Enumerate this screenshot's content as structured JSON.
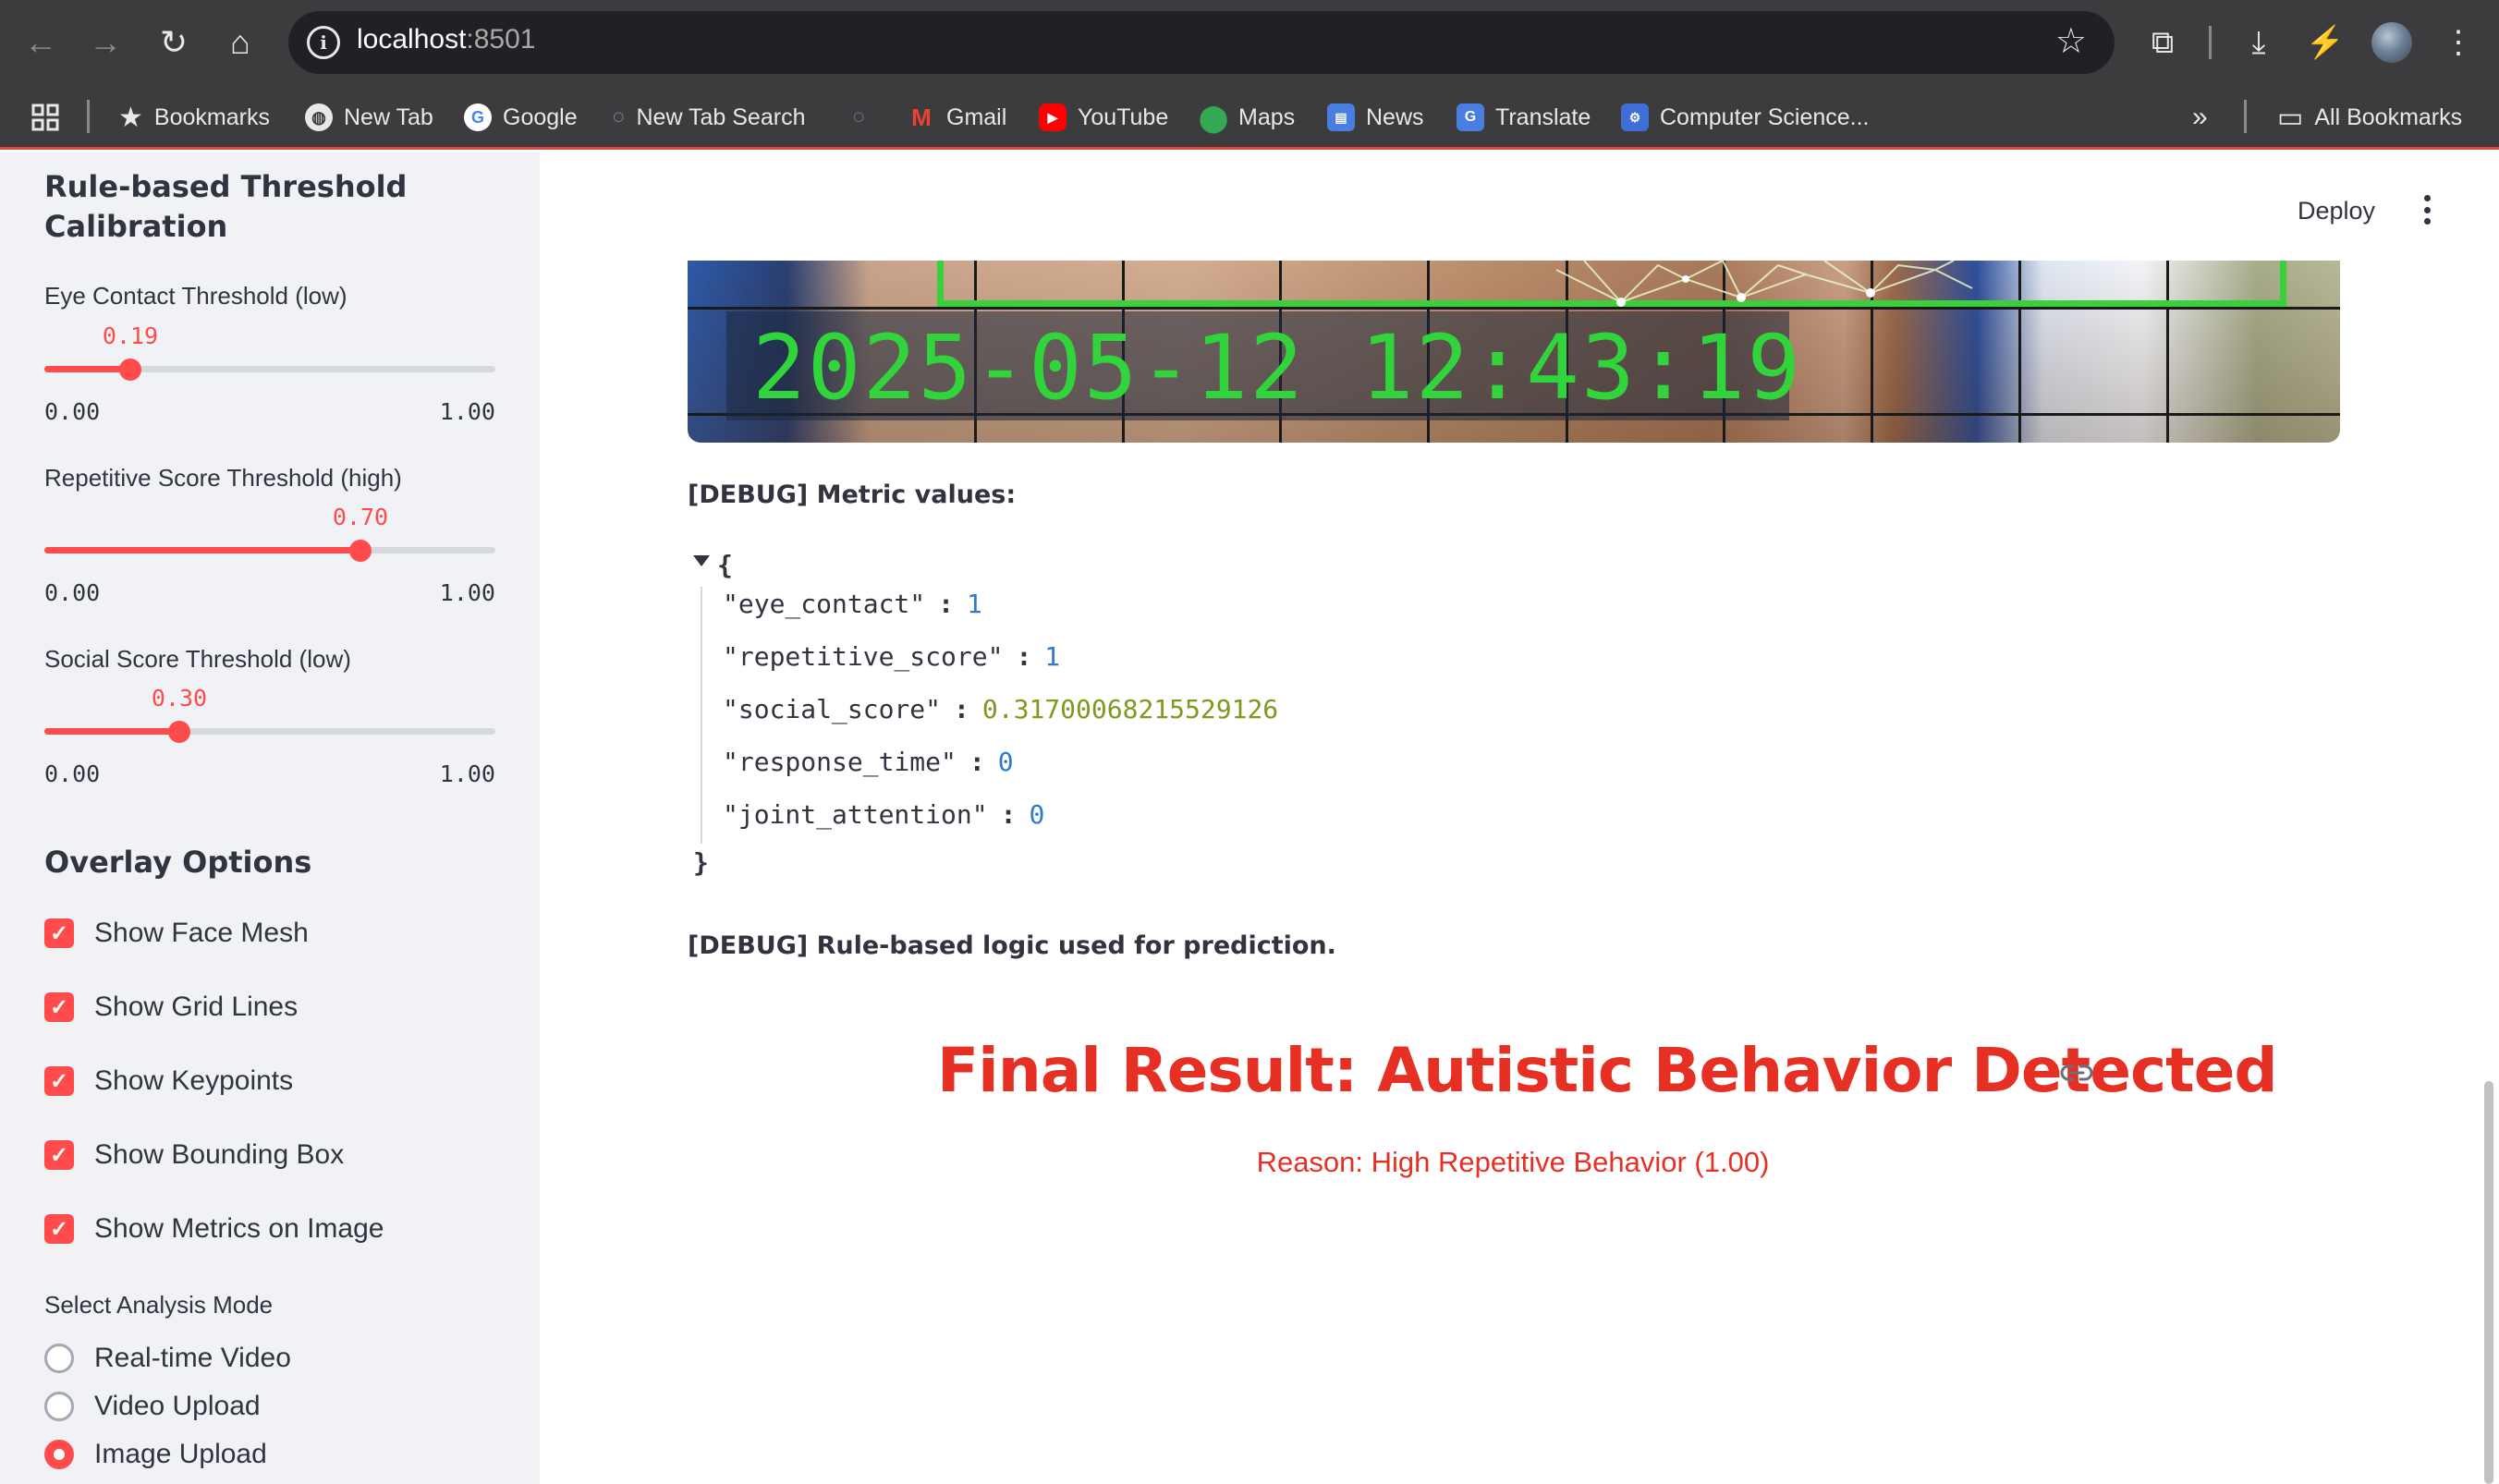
{
  "browser": {
    "url_host": "localhost",
    "url_port": ":8501",
    "bookmarks": [
      {
        "label": "Bookmarks",
        "icon": "star-icon"
      },
      {
        "label": "New Tab",
        "icon": "globe-icon"
      },
      {
        "label": "Google",
        "icon": "google-icon"
      },
      {
        "label": "New Tab Search",
        "icon": "search-icon"
      },
      {
        "label": "Gmail",
        "icon": "gmail-icon"
      },
      {
        "label": "YouTube",
        "icon": "youtube-icon"
      },
      {
        "label": "Maps",
        "icon": "maps-icon"
      },
      {
        "label": "News",
        "icon": "news-icon"
      },
      {
        "label": "Translate",
        "icon": "translate-icon"
      },
      {
        "label": "Computer Science...",
        "icon": "computer-science-icon"
      }
    ],
    "all_bookmarks": "All Bookmarks"
  },
  "sidebar": {
    "threshold_heading": "Rule-based Threshold Calibration",
    "sliders": [
      {
        "label": "Eye Contact Threshold (low)",
        "value": 0.19,
        "value_text": "0.19",
        "min": "0.00",
        "max": "1.00"
      },
      {
        "label": "Repetitive Score Threshold (high)",
        "value": 0.7,
        "value_text": "0.70",
        "min": "0.00",
        "max": "1.00"
      },
      {
        "label": "Social Score Threshold (low)",
        "value": 0.3,
        "value_text": "0.30",
        "min": "0.00",
        "max": "1.00"
      }
    ],
    "overlay_heading": "Overlay Options",
    "checkboxes": [
      {
        "label": "Show Face Mesh",
        "checked": true
      },
      {
        "label": "Show Grid Lines",
        "checked": true
      },
      {
        "label": "Show Keypoints",
        "checked": true
      },
      {
        "label": "Show Bounding Box",
        "checked": true
      },
      {
        "label": "Show Metrics on Image",
        "checked": true
      }
    ],
    "mode_label": "Select Analysis Mode",
    "modes": [
      {
        "label": "Real-time Video",
        "selected": false
      },
      {
        "label": "Video Upload",
        "selected": false
      },
      {
        "label": "Image Upload",
        "selected": true
      }
    ]
  },
  "main": {
    "deploy_label": "Deploy",
    "image_timestamp": "2025-05-12 12:43:19",
    "debug_metrics_label": "[DEBUG] Metric values:",
    "json_open": "{",
    "json_close": "}",
    "metrics": [
      {
        "key": "\"eye_contact\"",
        "value": "1",
        "kind": "num"
      },
      {
        "key": "\"repetitive_score\"",
        "value": "1",
        "kind": "num"
      },
      {
        "key": "\"social_score\"",
        "value": "0.31700068215529126",
        "kind": "float"
      },
      {
        "key": "\"response_time\"",
        "value": "0",
        "kind": "num"
      },
      {
        "key": "\"joint_attention\"",
        "value": "0",
        "kind": "num"
      }
    ],
    "debug_logic_label": "[DEBUG] Rule-based logic used for prediction.",
    "result_title": "Final Result: Autistic Behavior Detected",
    "reason": "Reason: High Repetitive Behavior (1.00)"
  },
  "colors": {
    "accent": "#ff4b4b",
    "result_red": "#e63024",
    "sidebar_bg": "#f0f2f6",
    "chrome_bg": "#3c3c3e"
  }
}
